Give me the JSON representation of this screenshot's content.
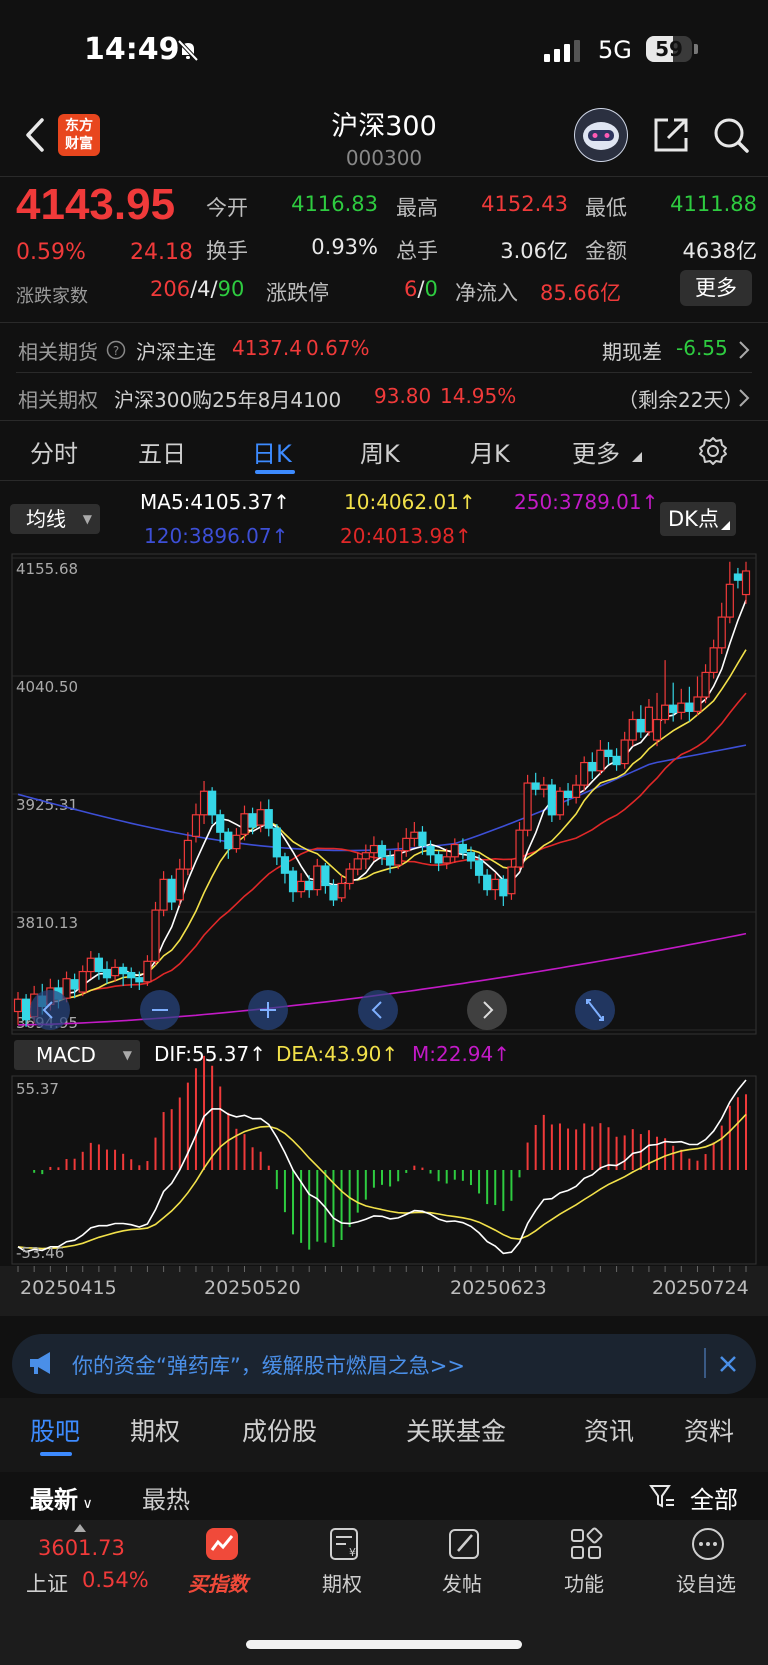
{
  "status_bar": {
    "time": "14:49",
    "network": "5G",
    "battery": "59",
    "battery_level": 0.59
  },
  "header": {
    "title": "沪深300",
    "code": "000300",
    "logo": "东方\n财富"
  },
  "quote": {
    "price": "4143.95",
    "change_pct": "0.59%",
    "change": "24.18",
    "open_label": "今开",
    "open": "4116.83",
    "high_label": "最高",
    "high": "4152.43",
    "low_label": "最低",
    "low": "4111.88",
    "turnover_label": "换手",
    "turnover": "0.93%",
    "volume_label": "总手",
    "volume": "3.06亿",
    "amount_label": "金额",
    "amount": "4638亿",
    "breadth_label": "涨跌家数",
    "breadth_up": "206",
    "breadth_flat": "4",
    "breadth_down": "90",
    "limit_label": "涨跌停",
    "limit_up": "6",
    "limit_down": "0",
    "netflow_label": "净流入",
    "netflow": "85.66亿",
    "more_label": "更多"
  },
  "futures": {
    "label": "相关期货",
    "name": "沪深主连",
    "price": "4137.4",
    "pct": "0.67%",
    "basis_label": "期现差",
    "basis": "-6.55"
  },
  "options": {
    "label": "相关期权",
    "name": "沪深300购25年8月4100",
    "price": "93.80",
    "pct": "14.95%",
    "remain": "（剩余22天）"
  },
  "period_tabs": [
    "分时",
    "五日",
    "日K",
    "周K",
    "月K",
    "更多"
  ],
  "ma": {
    "select_label": "均线",
    "ma5": "MA5:4105.37↑",
    "ma10": "10:4062.01↑",
    "ma250": "250:3789.01↑",
    "ma120": "120:3896.07↑",
    "ma20": "20:4013.98↑",
    "dk_label": "DK点"
  },
  "colors": {
    "up": "#f03a3a",
    "down": "#2ecc40",
    "accent": "#3d8bff",
    "ma5": "#ffffff",
    "ma10": "#f2e14a",
    "ma20": "#e02828",
    "ma120": "#3d4fd6",
    "ma250": "#c21ac6",
    "cyan": "#35d6e6"
  },
  "chart_data": [
    {
      "type": "candlestick",
      "y_axis_labels": [
        "4155.68",
        "4040.50",
        "3925.31",
        "3810.13",
        "3694.95"
      ],
      "ylim": [
        3694.95,
        4155.68
      ],
      "x_labels": [
        "20250415",
        "20250520",
        "20250623",
        "20250724"
      ],
      "candles": [
        [
          3713,
          3725,
          3700,
          3732
        ],
        [
          3725,
          3705,
          3698,
          3730
        ],
        [
          3708,
          3730,
          3702,
          3738
        ],
        [
          3728,
          3718,
          3710,
          3740
        ],
        [
          3720,
          3736,
          3714,
          3745
        ],
        [
          3736,
          3725,
          3716,
          3744
        ],
        [
          3726,
          3745,
          3722,
          3752
        ],
        [
          3744,
          3735,
          3726,
          3750
        ],
        [
          3732,
          3752,
          3728,
          3758
        ],
        [
          3752,
          3765,
          3745,
          3772
        ],
        [
          3765,
          3752,
          3744,
          3770
        ],
        [
          3754,
          3746,
          3740,
          3762
        ],
        [
          3748,
          3756,
          3742,
          3764
        ],
        [
          3756,
          3750,
          3738,
          3760
        ],
        [
          3751,
          3746,
          3736,
          3756
        ],
        [
          3746,
          3742,
          3734,
          3752
        ],
        [
          3742,
          3762,
          3738,
          3768
        ],
        [
          3762,
          3812,
          3758,
          3820
        ],
        [
          3812,
          3842,
          3806,
          3850
        ],
        [
          3842,
          3820,
          3812,
          3846
        ],
        [
          3822,
          3852,
          3816,
          3862
        ],
        [
          3852,
          3880,
          3846,
          3888
        ],
        [
          3884,
          3905,
          3878,
          3916
        ],
        [
          3905,
          3928,
          3896,
          3938
        ],
        [
          3928,
          3905,
          3896,
          3932
        ],
        [
          3905,
          3888,
          3878,
          3910
        ],
        [
          3888,
          3872,
          3862,
          3892
        ],
        [
          3872,
          3885,
          3868,
          3892
        ],
        [
          3886,
          3906,
          3880,
          3914
        ],
        [
          3906,
          3893,
          3886,
          3912
        ],
        [
          3895,
          3910,
          3888,
          3918
        ],
        [
          3910,
          3892,
          3884,
          3920
        ],
        [
          3892,
          3864,
          3856,
          3896
        ],
        [
          3864,
          3848,
          3838,
          3868
        ],
        [
          3850,
          3830,
          3820,
          3854
        ],
        [
          3830,
          3840,
          3824,
          3848
        ],
        [
          3840,
          3832,
          3824,
          3846
        ],
        [
          3832,
          3855,
          3826,
          3862
        ],
        [
          3855,
          3836,
          3828,
          3858
        ],
        [
          3836,
          3822,
          3816,
          3842
        ],
        [
          3824,
          3838,
          3820,
          3846
        ],
        [
          3838,
          3852,
          3832,
          3858
        ],
        [
          3852,
          3862,
          3846,
          3868
        ],
        [
          3862,
          3868,
          3852,
          3876
        ],
        [
          3868,
          3875,
          3860,
          3884
        ],
        [
          3875,
          3864,
          3856,
          3880
        ],
        [
          3864,
          3856,
          3848,
          3870
        ],
        [
          3856,
          3870,
          3852,
          3878
        ],
        [
          3870,
          3882,
          3864,
          3892
        ],
        [
          3882,
          3888,
          3874,
          3898
        ],
        [
          3888,
          3875,
          3866,
          3894
        ],
        [
          3874,
          3866,
          3858,
          3880
        ],
        [
          3866,
          3858,
          3850,
          3870
        ],
        [
          3858,
          3864,
          3852,
          3872
        ],
        [
          3864,
          3876,
          3858,
          3882
        ],
        [
          3876,
          3868,
          3862,
          3882
        ],
        [
          3868,
          3860,
          3852,
          3874
        ],
        [
          3860,
          3846,
          3838,
          3866
        ],
        [
          3846,
          3832,
          3826,
          3852
        ],
        [
          3832,
          3842,
          3822,
          3848
        ],
        [
          3842,
          3826,
          3816,
          3846
        ],
        [
          3828,
          3854,
          3822,
          3862
        ],
        [
          3854,
          3890,
          3850,
          3898
        ],
        [
          3890,
          3936,
          3884,
          3944
        ],
        [
          3936,
          3930,
          3924,
          3946
        ],
        [
          3930,
          3934,
          3922,
          3942
        ],
        [
          3934,
          3905,
          3898,
          3940
        ],
        [
          3905,
          3928,
          3900,
          3932
        ],
        [
          3928,
          3922,
          3914,
          3936
        ],
        [
          3922,
          3934,
          3916,
          3944
        ],
        [
          3934,
          3956,
          3928,
          3962
        ],
        [
          3956,
          3948,
          3940,
          3966
        ],
        [
          3948,
          3968,
          3944,
          3978
        ],
        [
          3968,
          3962,
          3954,
          3976
        ],
        [
          3962,
          3954,
          3948,
          3970
        ],
        [
          3955,
          3978,
          3950,
          3986
        ],
        [
          3978,
          3998,
          3972,
          4006
        ],
        [
          3998,
          3986,
          3980,
          4012
        ],
        [
          3986,
          4010,
          3982,
          4018
        ],
        [
          3978,
          3998,
          3972,
          4024
        ],
        [
          3998,
          4012,
          3994,
          4056
        ],
        [
          4012,
          4005,
          3996,
          4034
        ],
        [
          4005,
          4014,
          3998,
          4028
        ],
        [
          4014,
          4006,
          3996,
          4030
        ],
        [
          4006,
          4020,
          4002,
          4040
        ],
        [
          4020,
          4044,
          4014,
          4052
        ],
        [
          4044,
          4068,
          4038,
          4076
        ],
        [
          4068,
          4098,
          4062,
          4112
        ],
        [
          4098,
          4130,
          4092,
          4152
        ],
        [
          4140,
          4134,
          4126,
          4146
        ],
        [
          4120,
          4143,
          4111,
          4152
        ]
      ]
    },
    {
      "type": "macd",
      "select_label": "MACD",
      "dif_label": "DIF:55.37↑",
      "dea_label": "DEA:43.90↑",
      "m_label": "M:22.94↑",
      "y_axis_labels": [
        "55.37",
        "-53.46"
      ],
      "ylim": [
        -53.46,
        55.37
      ]
    }
  ],
  "banner": {
    "text": "你的资金“弹药库”，缓解股市燃眉之急>>"
  },
  "lower_tabs": [
    "股吧",
    "期权",
    "成份股",
    "关联基金",
    "资讯",
    "资料"
  ],
  "filters": {
    "latest": "最新",
    "hot": "最热",
    "all": "全部"
  },
  "bottom_nav": {
    "index_price": "3601.73",
    "index_name": "上证",
    "index_pct": "0.54%",
    "buy_index": "买指数",
    "options": "期权",
    "post": "发帖",
    "features": "功能",
    "watchlist": "设自选"
  }
}
